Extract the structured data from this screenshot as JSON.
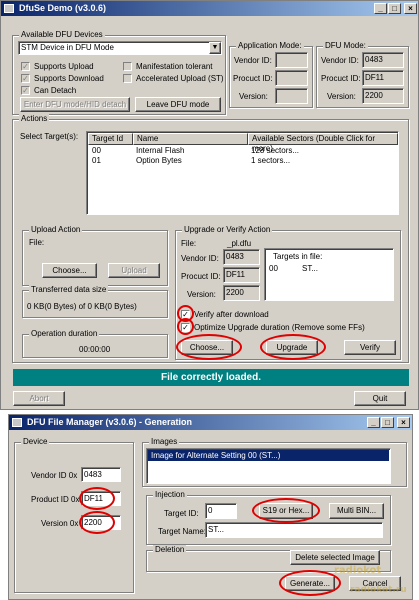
{
  "main_window": {
    "title": "DfuSe Demo (v3.0.6)",
    "title_buttons": [
      "_",
      "□",
      "×"
    ],
    "dfu_devices": {
      "group_label": "Available DFU Devices",
      "device_selected": "STM Device in DFU Mode",
      "supports_upload": "Supports Upload",
      "supports_download": "Supports Download",
      "can_detach": "Can Detach",
      "manifestation_tolerant": "Manifestation tolerant",
      "accelerated_upload": "Accelerated Upload (ST)",
      "enter_dfu_btn": "Enter DFU mode/HID detach",
      "leave_dfu_btn": "Leave DFU mode"
    },
    "app_mode": {
      "group_label": "Application Mode:",
      "vendor_id_label": "Vendor ID:",
      "product_id_label": "Procuct ID:",
      "version_label": "Version:"
    },
    "dfu_mode": {
      "group_label": "DFU Mode:",
      "vendor_id_label": "Vendor ID:",
      "vendor_id": "0483",
      "product_id_label": "Procuct ID:",
      "product_id": "DF11",
      "version_label": "Version:",
      "version": "2200"
    },
    "actions": {
      "group_label": "Actions",
      "select_targets_label": "Select Target(s):",
      "columns": [
        "Target Id",
        "Name",
        "Available Sectors (Double Click for more)"
      ],
      "rows": [
        [
          "00",
          "Internal Flash",
          "128 sectors..."
        ],
        [
          "01",
          "Option Bytes",
          "1 sectors..."
        ]
      ]
    },
    "upload_action": {
      "group_label": "Upload Action",
      "file_label": "File:",
      "choose_btn": "Choose...",
      "upload_btn": "Upload"
    },
    "transferred": {
      "group_label": "Transferred data size",
      "value": "0 KB(0 Bytes) of 0 KB(0 Bytes)"
    },
    "operation": {
      "group_label": "Operation duration",
      "value": "00:00:00"
    },
    "upgrade": {
      "group_label": "Upgrade or Verify Action",
      "file_label": "File:",
      "file_value": "_pl.dfu",
      "vendor_id_label": "Vendor ID:",
      "vendor_id": "0483",
      "product_id_label": "Procuct ID:",
      "product_id": "DF11",
      "version_label": "Version:",
      "version": "2200",
      "targets_label": "Targets in file:",
      "targets": [
        [
          "00",
          "ST..."
        ]
      ],
      "verify_after_download": "Verify after download",
      "optimize": "Optimize Upgrade duration (Remove some FFs)",
      "choose_btn": "Choose...",
      "upgrade_btn": "Upgrade",
      "verify_btn": "Verify"
    },
    "status": "File correctly loaded.",
    "abort_btn": "Abort",
    "quit_btn": "Quit"
  },
  "file_manager": {
    "title": "DFU File Manager (v3.0.6) - Generation",
    "title_buttons": [
      "_",
      "□",
      "×"
    ],
    "device": {
      "group_label": "Device",
      "vendor_id_label": "Vendor ID 0x",
      "vendor_id": "0483",
      "product_id_label": "Product ID 0x",
      "product_id": "DF11",
      "version_label": "Version 0x",
      "version": "2200"
    },
    "images": {
      "group_label": "Images",
      "selected_item": "Image for Alternate Setting 00 (ST...)"
    },
    "injection": {
      "group_label": "Injection",
      "target_id_label": "Target ID:",
      "target_id": "0",
      "s19_btn": "S19 or Hex...",
      "multi_bin_btn": "Multi BIN...",
      "target_name_label": "Target Name:",
      "target_name": "ST..."
    },
    "deletion": {
      "group_label": "Deletion",
      "delete_btn": "Delete selected Image"
    },
    "generate_btn": "Generate...",
    "cancel_btn": "Cancel"
  },
  "watermark": {
    "logo_text": "radiokot",
    "domain": "radiokot.ru"
  },
  "colors": {
    "title_active": "#0a246a",
    "status_bg": "#008080",
    "highlight": "#e00000",
    "selection": "#0a246a"
  }
}
